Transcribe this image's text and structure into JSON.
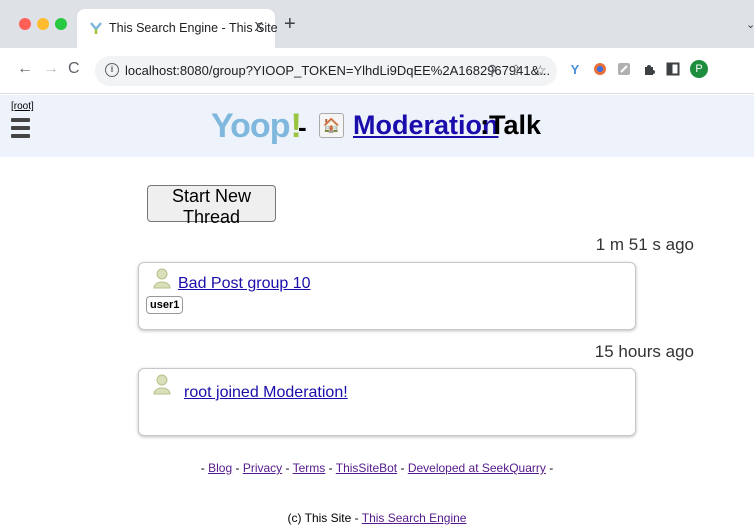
{
  "browser": {
    "tab_title": "This Search Engine - This Site",
    "tab_close": "X",
    "new_tab": "+",
    "url": "localhost:8080/group?YIOOP_TOKEN=YlhdLi9DqEE%2A1682967941&...",
    "profile_initial": "P",
    "colors": {
      "close": "#ff5f57",
      "minimize": "#febc2e",
      "maximize": "#28c840"
    }
  },
  "header": {
    "root_label": "[root]",
    "logo_text": "Yoop",
    "logo_bang": "!",
    "separator": "-",
    "group_name": "Moderation",
    "group_suffix": ":Talk"
  },
  "main": {
    "new_thread_label": "Start New Thread",
    "threads": [
      {
        "time": "1 m 51 s ago",
        "title": "Bad Post group 10",
        "user": "user1"
      },
      {
        "time": "15 hours ago",
        "title": "root joined Moderation!"
      }
    ]
  },
  "footer": {
    "dash_open": "-",
    "blog": "Blog",
    "privacy": "Privacy",
    "terms": "Terms",
    "bot": "ThisSiteBot",
    "developed": "Developed at SeekQuarry",
    "sep": "-",
    "dash_close": "-",
    "copyright": "(c) This Site -",
    "engine_link": "This Search Engine"
  }
}
